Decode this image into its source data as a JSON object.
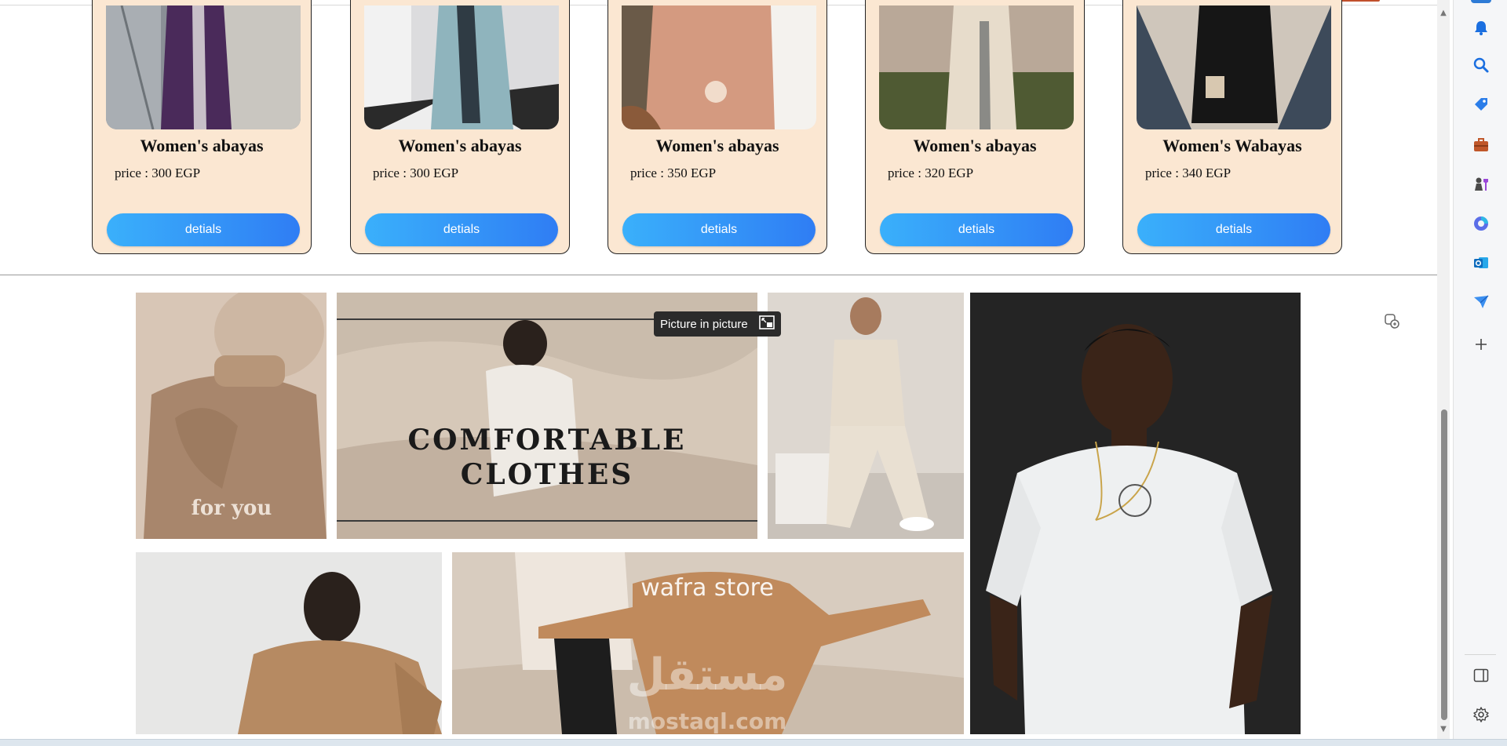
{
  "products": [
    {
      "title": "Women's abayas",
      "price": "price : 300 EGP",
      "button": "detials"
    },
    {
      "title": "Women's abayas",
      "price": "price : 300 EGP",
      "button": "detials"
    },
    {
      "title": "Women's abayas",
      "price": "price : 350 EGP",
      "button": "detials"
    },
    {
      "title": "Women's abayas",
      "price": "price : 320 EGP",
      "button": "detials"
    },
    {
      "title": "Women's Wabayas",
      "price": "price : 340 EGP",
      "button": "detials"
    }
  ],
  "banner": {
    "tile1_caption": "for you",
    "headline_line1": "COMFORTABLE",
    "headline_line2": "CLOTHES",
    "store_name": "wafra store",
    "watermark_ar": "مستقل",
    "watermark_en": "mostaql.com"
  },
  "pip_label": "Picture in picture",
  "sidebar_icons": [
    "bell-icon",
    "search-icon",
    "tag-icon",
    "briefcase-icon",
    "chess-icon",
    "copilot-icon",
    "outlook-icon",
    "send-icon",
    "add-icon",
    "split-panel-icon",
    "settings-icon"
  ],
  "colors": {
    "card_bg": "#fbe7d2",
    "button_start": "#3ab0fb",
    "button_end": "#2f7df4"
  }
}
